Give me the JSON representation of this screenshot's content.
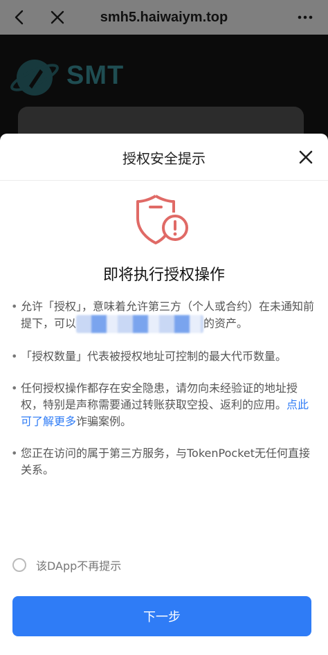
{
  "browser": {
    "url": "smh5.haiwaiym.top",
    "back_icon": "chevron-left-icon",
    "close_icon": "close-icon",
    "more_icon": "more-icon"
  },
  "dapp": {
    "logo_text": "SMT"
  },
  "sheet": {
    "title": "授权安全提示",
    "heading": "即将执行授权操作",
    "bullets": [
      {
        "text_before": "允许「授权」，意味着允许第三方（个人或合约）在未通知前提下，可以",
        "text_after": "的资产。"
      },
      {
        "text": "「授权数量」代表被授权地址可控制的最大代币数量。"
      },
      {
        "text_before": "任何授权操作都存在安全隐患，请勿向未经验证的地址授权，特别是声称需要通过转账获取空投、返利的应用。",
        "link": "点此可了解更多",
        "text_after": "诈骗案例。"
      },
      {
        "text": "您正在访问的属于第三方服务，与TokenPocket无任何直接关系。"
      }
    ],
    "checkbox_label": "该DApp不再提示",
    "next_button": "下一步"
  },
  "colors": {
    "accent": "#2f7cf6",
    "warning": "#e06a66",
    "topbar": "#7f7f7f"
  }
}
